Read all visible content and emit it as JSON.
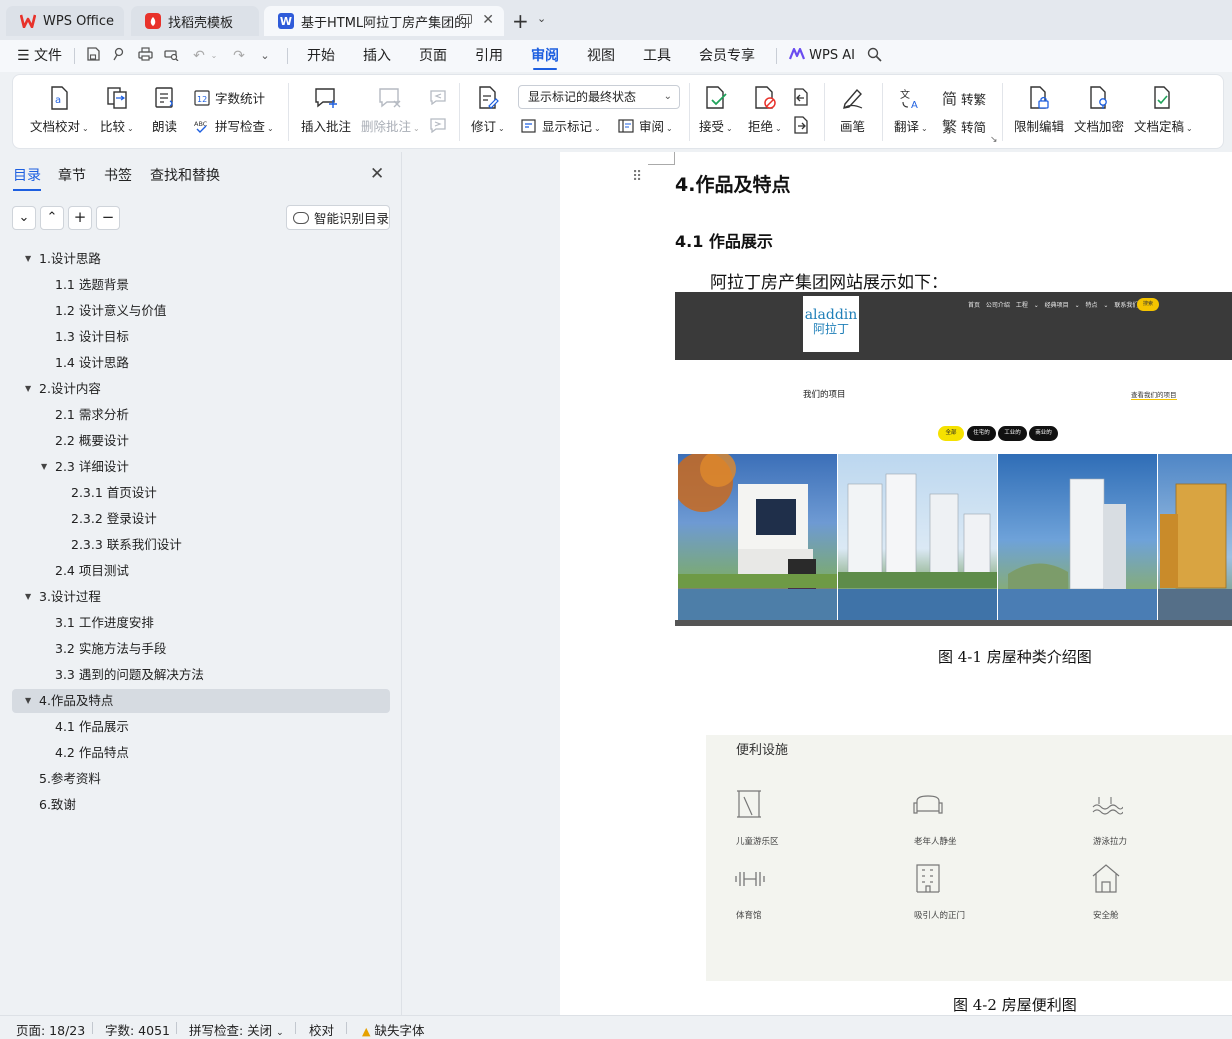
{
  "tabs": [
    {
      "label": "WPS Office"
    },
    {
      "label": "找稻壳模板"
    },
    {
      "label": "基于HTML阿拉丁房产集团的网"
    }
  ],
  "menubar": {
    "file": "文件",
    "items": [
      "开始",
      "插入",
      "页面",
      "引用",
      "审阅",
      "视图",
      "工具",
      "会员专享"
    ],
    "active": "审阅",
    "ai": "WPS AI"
  },
  "ribbon": {
    "proofread": "文档校对",
    "compare": "比较",
    "read_aloud": "朗读",
    "word_count": "字数统计",
    "spell_check": "拼写检查",
    "insert_comment": "插入批注",
    "delete_comment": "删除批注",
    "track_changes": "修订",
    "markup_state": "显示标记的最终状态",
    "show_markup": "显示标记",
    "review": "审阅",
    "accept": "接受",
    "reject": "拒绝",
    "pen": "画笔",
    "translate": "翻译",
    "to_traditional": "转繁",
    "to_simplified": "转简",
    "restrict_edit": "限制编辑",
    "encrypt": "文档加密",
    "finalize": "文档定稿"
  },
  "nav": {
    "tabs": [
      "目录",
      "章节",
      "书签",
      "查找和替换"
    ],
    "smart_toc": "智能识别目录",
    "toc": [
      {
        "text": "1.设计思路",
        "level": 1,
        "arrow": true
      },
      {
        "text": "1.1 选题背景",
        "level": 2
      },
      {
        "text": "1.2 设计意义与价值",
        "level": 2
      },
      {
        "text": "1.3 设计目标",
        "level": 2
      },
      {
        "text": "1.4 设计思路",
        "level": 2
      },
      {
        "text": "2.设计内容",
        "level": 1,
        "arrow": true
      },
      {
        "text": "2.1 需求分析",
        "level": 2
      },
      {
        "text": "2.2 概要设计",
        "level": 2
      },
      {
        "text": "2.3 详细设计",
        "level": 2,
        "arrow": true
      },
      {
        "text": "2.3.1 首页设计",
        "level": 3
      },
      {
        "text": "2.3.2 登录设计",
        "level": 3
      },
      {
        "text": "2.3.3 联系我们设计",
        "level": 3
      },
      {
        "text": "2.4 项目测试",
        "level": 2
      },
      {
        "text": "3.设计过程",
        "level": 1,
        "arrow": true
      },
      {
        "text": "3.1 工作进度安排",
        "level": 2
      },
      {
        "text": "3.2 实施方法与手段",
        "level": 2
      },
      {
        "text": "3.3 遇到的问题及解决方法",
        "level": 2
      },
      {
        "text": "4.作品及特点",
        "level": 1,
        "arrow": true,
        "selected": true
      },
      {
        "text": "4.1 作品展示",
        "level": 2
      },
      {
        "text": "4.2 作品特点",
        "level": 2
      },
      {
        "text": "5.参考资料",
        "level": 1
      },
      {
        "text": "6.致谢",
        "level": 1
      }
    ]
  },
  "doc": {
    "heading1": "4.作品及特点",
    "heading2": "4.1 作品展示",
    "paragraph": "阿拉丁房产集团网站展示如下：",
    "figure1": {
      "logo_en": "aladdin",
      "logo_cn": "阿拉丁",
      "nav": "首页  公司介绍  工程 ⌄  经典项目 ⌄  特点 ⌄  联系我们 ⌄",
      "search": "搜索",
      "section_title": "我们的项目",
      "view_all": "查看我们的项目",
      "filters": [
        "全部",
        "住宅的",
        "工业的",
        "商业的"
      ],
      "caption": "图 4-1  房屋种类介绍图"
    },
    "figure2": {
      "title": "便利设施",
      "items": [
        "儿童游乐区",
        "老年人静坐",
        "游泳拉力",
        "体育馆",
        "吸引人的正门",
        "安全舱"
      ],
      "caption": "图 4-2  房屋便利图"
    }
  },
  "status": {
    "page": "页面: 18/23",
    "words": "字数: 4051",
    "spell": "拼写检查: 关闭",
    "proof": "校对",
    "missing_font": "缺失字体"
  },
  "colors": {
    "accent": "#1d5fe0",
    "wps_red": "#e8322b",
    "doc_blue": "#2f5bd9",
    "site_yellow": "#f5c400"
  }
}
